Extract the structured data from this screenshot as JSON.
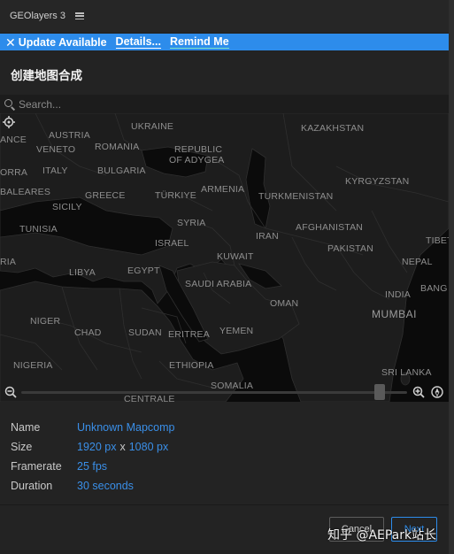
{
  "panel": {
    "title": "GEOlayers 3",
    "menu_icon": "hamburger-icon"
  },
  "update_bar": {
    "close_glyph": "✕",
    "message": "Update Available",
    "details_label": "Details...",
    "remind_label": "Remind Me",
    "color": "#2d8ceb"
  },
  "main_title": "创建地图合成",
  "search": {
    "placeholder": "Search..."
  },
  "map": {
    "labels": [
      "UKRAINE",
      "AUSTRIA",
      "ROMANIA",
      "REPUBLIC",
      "OF ADYGEA",
      "KAZAKHSTAN",
      "VENETO",
      "ANCE",
      "ORRA",
      "ITALY",
      "BULGARIA",
      "KYRGYZSTAN",
      "BALEARES",
      "GREECE",
      "TÜRKIYE",
      "ARMENIA",
      "TURKMENISTAN",
      "SICILY",
      "SYRIA",
      "TUNISIA",
      "ISRAEL",
      "IRAN",
      "AFGHANISTAN",
      "TIBET",
      "PAKISTAN",
      "KUWAIT",
      "NEPAL",
      "RIA",
      "LIBYA",
      "EGYPT",
      "SAUDI ARABIA",
      "INDIA",
      "BANG",
      "OMAN",
      "NIGER",
      "CHAD",
      "SUDAN",
      "ERITREA",
      "YEMEN",
      "NIGERIA",
      "ETHIOPIA",
      "SRI LANKA",
      "SOMALIA",
      "CENTRALE"
    ],
    "city_labels": [
      "MUMBAI"
    ],
    "zoom_level": 0.94
  },
  "composition": {
    "name_label": "Name",
    "name_value": "Unknown Mapcomp",
    "size_label": "Size",
    "width_value": "1920 px",
    "size_sep": "x",
    "height_value": "1080 px",
    "framerate_label": "Framerate",
    "framerate_value": "25 fps",
    "duration_label": "Duration",
    "duration_value": "30 seconds"
  },
  "buttons": {
    "cancel": "Cancel",
    "next": "Next"
  },
  "watermark": "知乎 @AEPark站长",
  "colors": {
    "accent": "#2d8ceb",
    "background": "#232323",
    "map_background": "#0b0b0b"
  }
}
